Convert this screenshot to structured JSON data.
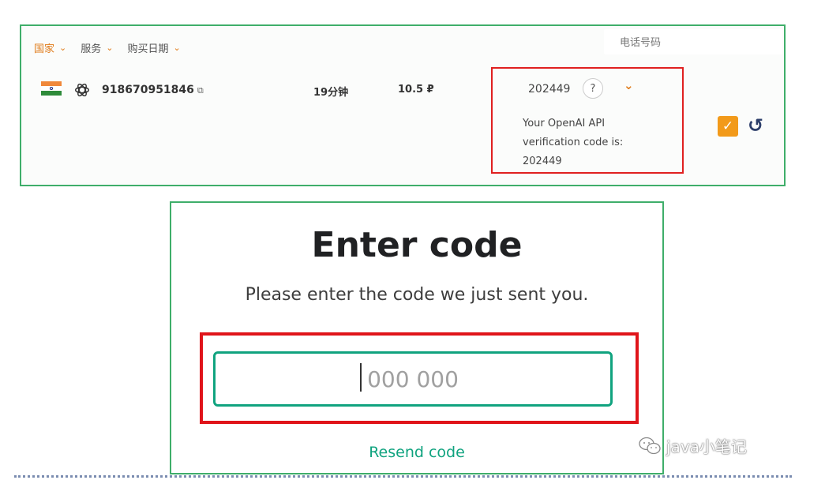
{
  "top_panel": {
    "filters": [
      {
        "label": "国家",
        "active": true
      },
      {
        "label": "服务",
        "active": false
      },
      {
        "label": "购买日期",
        "active": false
      }
    ],
    "phone_search_placeholder": "电话号码",
    "row": {
      "country_icon": "india-flag-icon",
      "service_icon": "openai-icon",
      "phone_number": "918670951846",
      "duration": "19分钟",
      "price": "10.5 ₽",
      "sms_code": "202449",
      "help_label": "?",
      "sms_message": "Your OpenAI API verification code is: 202449",
      "status_icon": "checkbox-checked-icon",
      "refresh_icon": "undo-icon"
    }
  },
  "verify_dialog": {
    "title": "Enter code",
    "subtitle": "Please enter the code we just sent you.",
    "code_placeholder": "000 000",
    "resend_label": "Resend code"
  },
  "watermark": {
    "text": "java小笔记"
  },
  "colors": {
    "accent_orange": "#f29a1a",
    "highlight_red": "#e0141a",
    "panel_green": "#3fae6a",
    "openai_green": "#10a37f"
  }
}
